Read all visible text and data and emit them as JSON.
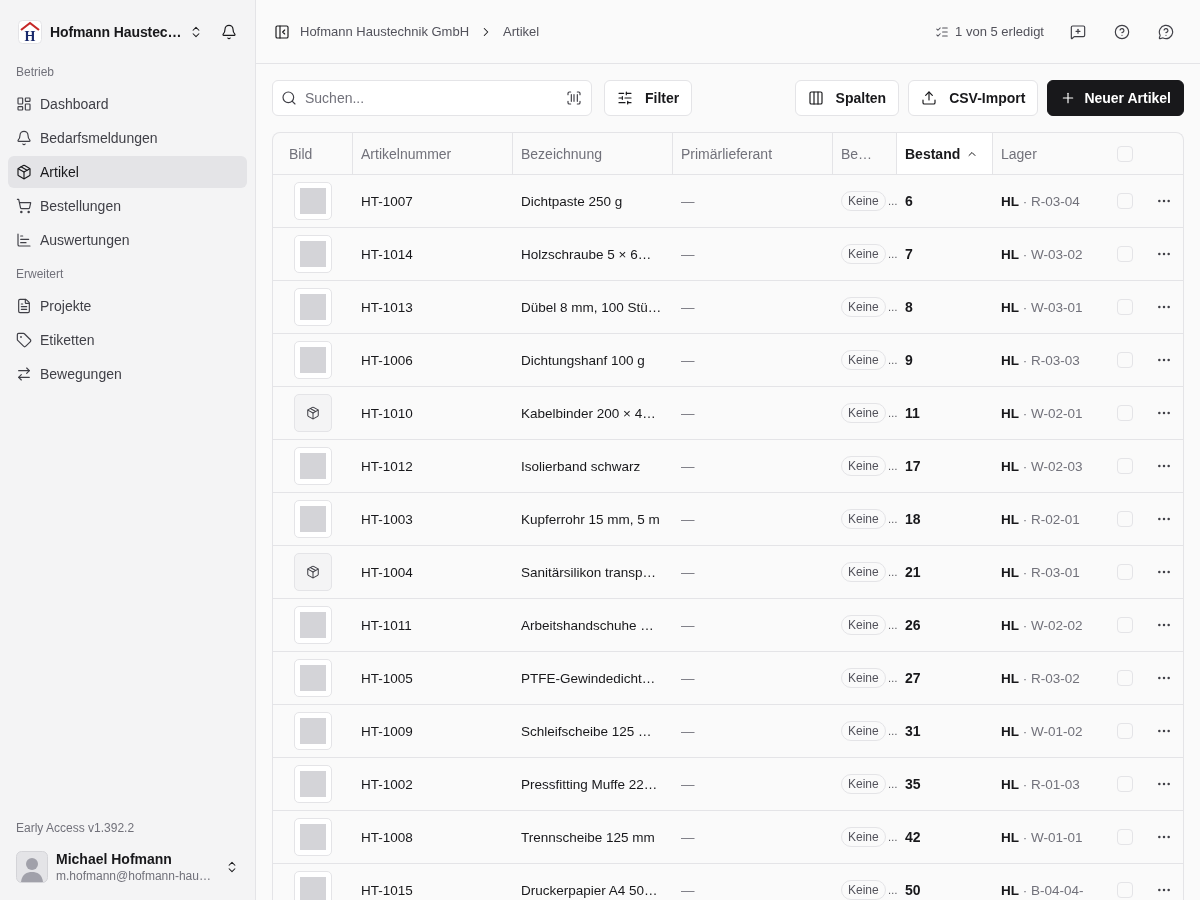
{
  "sidebar": {
    "brand": {
      "logo": "H",
      "name": "Hofmann Haustec…"
    },
    "sections": [
      {
        "title": "Betrieb",
        "items": [
          {
            "label": "Dashboard",
            "selected": false
          },
          {
            "label": "Bedarfsmeldungen",
            "selected": false
          },
          {
            "label": "Artikel",
            "selected": true
          },
          {
            "label": "Bestellungen",
            "selected": false
          },
          {
            "label": "Auswertungen",
            "selected": false
          }
        ]
      },
      {
        "title": "Erweitert",
        "items": [
          {
            "label": "Projekte",
            "selected": false
          },
          {
            "label": "Etiketten",
            "selected": false
          },
          {
            "label": "Bewegungen",
            "selected": false
          }
        ]
      }
    ],
    "version": "Early Access v1.392.2",
    "user": {
      "name": "Michael Hofmann",
      "email": "m.hofmann@hofmann-hau…"
    }
  },
  "header": {
    "breadcrumb": [
      "Hofmann Haustechnik GmbH",
      "Artikel"
    ],
    "progress": "1 von 5 erledigt"
  },
  "toolbar": {
    "search": {
      "placeholder": "Suchen..."
    },
    "filter": "Filter",
    "actions": [
      {
        "label": "Spalten",
        "primary": false
      },
      {
        "label": "CSV-Import",
        "primary": false
      },
      {
        "label": "Neuer Artikel",
        "primary": true
      }
    ]
  },
  "table": {
    "columns": [
      {
        "label": "Bild",
        "sorted": false
      },
      {
        "label": "Artikelnummer",
        "sorted": false
      },
      {
        "label": "Bezeichnung",
        "sorted": false
      },
      {
        "label": "Primärlieferant",
        "sorted": false
      },
      {
        "label": "Be…",
        "sorted": false
      },
      {
        "label": "Bestand",
        "sorted": true
      },
      {
        "label": "Lager",
        "sorted": false
      }
    ],
    "select_all": {
      "checked": false
    },
    "rows": [
      {
        "kind": "photo",
        "number": "HT-1007",
        "name": "Dichtpaste 250 g",
        "supplier": "—",
        "badge": "Keine",
        "overflow": "…",
        "stock": "6",
        "location": "**HL** · R-03-04",
        "checked": false
      },
      {
        "kind": "photo",
        "number": "HT-1014",
        "name": "Holzschraube 5 × 6…",
        "supplier": "—",
        "badge": "Keine",
        "overflow": "…",
        "stock": "7",
        "location": "**HL** · W-03-02",
        "checked": false
      },
      {
        "kind": "photo",
        "number": "HT-1013",
        "name": "Dübel 8 mm, 100 Stü…",
        "supplier": "—",
        "badge": "Keine",
        "overflow": "…",
        "stock": "8",
        "location": "**HL** · W-03-01",
        "checked": false
      },
      {
        "kind": "photo",
        "number": "HT-1006",
        "name": "Dichtungshanf 100 g",
        "supplier": "—",
        "badge": "Keine",
        "overflow": "…",
        "stock": "9",
        "location": "**HL** · R-03-03",
        "checked": false
      },
      {
        "kind": "placeholder",
        "number": "HT-1010",
        "name": "Kabelbinder 200 × 4…",
        "supplier": "—",
        "badge": "Keine",
        "overflow": "…",
        "stock": "11",
        "location": "**HL** · W-02-01",
        "checked": false
      },
      {
        "kind": "photo",
        "number": "HT-1012",
        "name": "Isolierband schwarz",
        "supplier": "—",
        "badge": "Keine",
        "overflow": "…",
        "stock": "17",
        "location": "**HL** · W-02-03",
        "checked": false
      },
      {
        "kind": "photo",
        "number": "HT-1003",
        "name": "Kupferrohr 15 mm, 5 m",
        "supplier": "—",
        "badge": "Keine",
        "overflow": "…",
        "stock": "18",
        "location": "**HL** · R-02-01",
        "checked": false
      },
      {
        "kind": "placeholder",
        "number": "HT-1004",
        "name": "Sanitärsilikon transp…",
        "supplier": "—",
        "badge": "Keine",
        "overflow": "…",
        "stock": "21",
        "location": "**HL** · R-03-01",
        "checked": false
      },
      {
        "kind": "photo",
        "number": "HT-1011",
        "name": "Arbeitshandschuhe …",
        "supplier": "—",
        "badge": "Keine",
        "overflow": "…",
        "stock": "26",
        "location": "**HL** · W-02-02",
        "checked": false
      },
      {
        "kind": "photo",
        "number": "HT-1005",
        "name": "PTFE-Gewindedicht…",
        "supplier": "—",
        "badge": "Keine",
        "overflow": "…",
        "stock": "27",
        "location": "**HL** · R-03-02",
        "checked": false
      },
      {
        "kind": "photo",
        "number": "HT-1009",
        "name": "Schleifscheibe 125 …",
        "supplier": "—",
        "badge": "Keine",
        "overflow": "…",
        "stock": "31",
        "location": "**HL** · W-01-02",
        "checked": false
      },
      {
        "kind": "photo",
        "number": "HT-1002",
        "name": "Pressfitting Muffe 22…",
        "supplier": "—",
        "badge": "Keine",
        "overflow": "…",
        "stock": "35",
        "location": "**HL** · R-01-03",
        "checked": false
      },
      {
        "kind": "photo",
        "number": "HT-1008",
        "name": "Trennscheibe 125 mm",
        "supplier": "—",
        "badge": "Keine",
        "overflow": "…",
        "stock": "42",
        "location": "**HL** · W-01-01",
        "checked": false
      },
      {
        "kind": "photo",
        "number": "HT-1015",
        "name": "Druckerpapier A4 50…",
        "supplier": "—",
        "badge": "Keine",
        "overflow": "…",
        "stock": "50",
        "location": "**HL** · B-04-04-",
        "checked": false
      }
    ]
  }
}
